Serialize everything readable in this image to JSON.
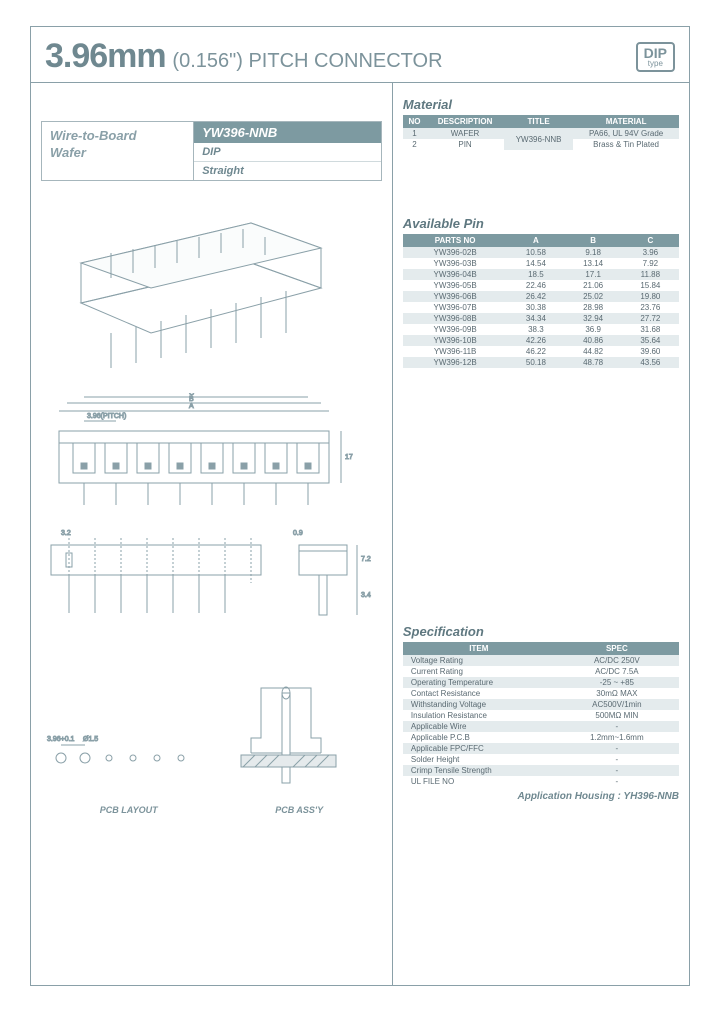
{
  "header": {
    "size": "3.96mm",
    "inch": "(0.156\")",
    "label": "PITCH CONNECTOR",
    "badge": "DIP",
    "badge_sub": "type"
  },
  "ident": {
    "type1": "Wire-to-Board",
    "type2": "Wafer",
    "partno": "YW396-NNB",
    "sub1": "DIP",
    "sub2": "Straight"
  },
  "material": {
    "title": "Material",
    "headers": [
      "NO",
      "DESCRIPTION",
      "TITLE",
      "MATERIAL"
    ],
    "rows": [
      [
        "1",
        "WAFER",
        "YW396-NNB",
        "PA66, UL 94V Grade"
      ],
      [
        "2",
        "PIN",
        "",
        "Brass & Tin Plated"
      ]
    ]
  },
  "pins": {
    "title": "Available Pin",
    "headers": [
      "PARTS NO",
      "A",
      "B",
      "C"
    ],
    "rows": [
      [
        "YW396-02B",
        "10.58",
        "9.18",
        "3.96"
      ],
      [
        "YW396-03B",
        "14.54",
        "13.14",
        "7.92"
      ],
      [
        "YW396-04B",
        "18.5",
        "17.1",
        "11.88"
      ],
      [
        "YW396-05B",
        "22.46",
        "21.06",
        "15.84"
      ],
      [
        "YW396-06B",
        "26.42",
        "25.02",
        "19.80"
      ],
      [
        "YW396-07B",
        "30.38",
        "28.98",
        "23.76"
      ],
      [
        "YW396-08B",
        "34.34",
        "32.94",
        "27.72"
      ],
      [
        "YW396-09B",
        "38.3",
        "36.9",
        "31.68"
      ],
      [
        "YW396-10B",
        "42.26",
        "40.86",
        "35.64"
      ],
      [
        "YW396-11B",
        "46.22",
        "44.82",
        "39.60"
      ],
      [
        "YW396-12B",
        "50.18",
        "48.78",
        "43.56"
      ]
    ]
  },
  "spec": {
    "title": "Specification",
    "headers": [
      "ITEM",
      "SPEC"
    ],
    "rows": [
      [
        "Voltage Rating",
        "AC/DC 250V"
      ],
      [
        "Current Rating",
        "AC/DC 7.5A"
      ],
      [
        "Operating Temperature",
        "-25 ~ +85"
      ],
      [
        "Contact Resistance",
        "30mΩ MAX"
      ],
      [
        "Withstanding Voltage",
        "AC500V/1min"
      ],
      [
        "Insulation Resistance",
        "500MΩ MIN"
      ],
      [
        "Applicable Wire",
        "-"
      ],
      [
        "Applicable P.C.B",
        "1.2mm~1.6mm"
      ],
      [
        "Applicable FPC/FFC",
        "-"
      ],
      [
        "Solder Height",
        "-"
      ],
      [
        "Crimp Tensile Strength",
        "-"
      ],
      [
        "UL FILE NO",
        "-"
      ]
    ]
  },
  "app_housing": "Application Housing : YH396-NNB",
  "pcb": {
    "layout": "PCB LAYOUT",
    "assy": "PCB ASS'Y"
  },
  "dims": {
    "pitch": "3.96(PITCH)",
    "a": "A",
    "b": "B",
    "c": "C",
    "h": "17",
    "t": "3.2",
    "w": "0.9",
    "side": "7.2",
    "pin": "3.4",
    "hole": "Ø1.5",
    "pitch2": "3.96+0.1"
  }
}
